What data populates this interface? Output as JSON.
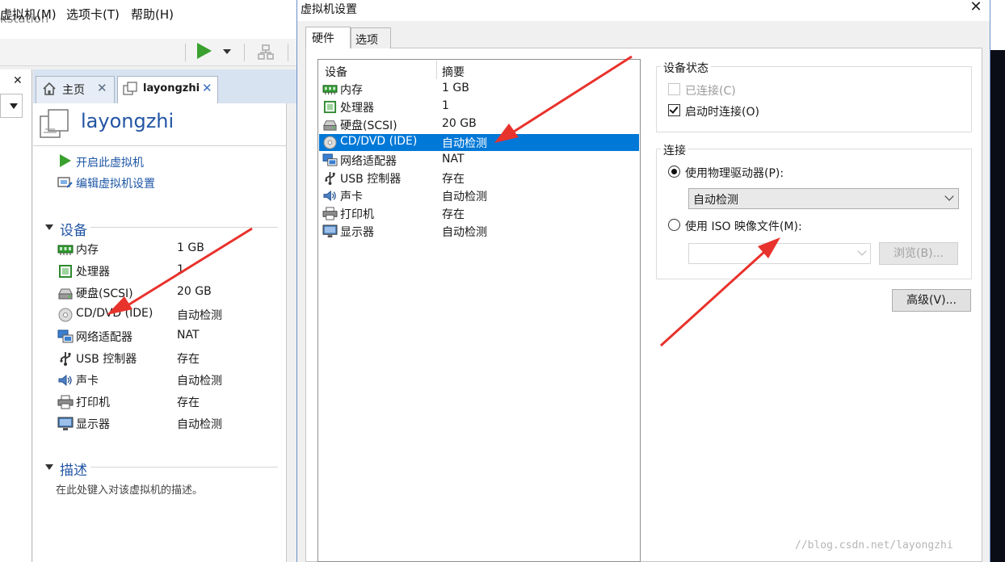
{
  "background_window": {
    "title": "kstation",
    "menu": [
      "虚拟机(M)",
      "选项卡(T)",
      "帮助(H)"
    ],
    "tabs": [
      {
        "label": "主页"
      },
      {
        "label": "layongzhi"
      }
    ],
    "vm_name": "layongzhi",
    "actions": [
      "开启此虚拟机",
      "编辑虚拟机设置"
    ],
    "devices_section": "设备",
    "devices": [
      {
        "icon": "memory-icon",
        "name": "内存",
        "value": "1 GB"
      },
      {
        "icon": "processor-icon",
        "name": "处理器",
        "value": "1"
      },
      {
        "icon": "hard-disk-icon",
        "name": "硬盘(SCSI)",
        "value": "20 GB"
      },
      {
        "icon": "cd-dvd-icon",
        "name": "CD/DVD (IDE)",
        "value": "自动检测"
      },
      {
        "icon": "network-adapter-icon",
        "name": "网络适配器",
        "value": "NAT"
      },
      {
        "icon": "usb-icon",
        "name": "USB 控制器",
        "value": "存在"
      },
      {
        "icon": "sound-icon",
        "name": "声卡",
        "value": "自动检测"
      },
      {
        "icon": "printer-icon",
        "name": "打印机",
        "value": "存在"
      },
      {
        "icon": "display-icon",
        "name": "显示器",
        "value": "自动检测"
      }
    ],
    "description_section": "描述",
    "description_placeholder": "在此处键入对该虚拟机的描述。"
  },
  "dialog": {
    "title": "虚拟机设置",
    "tabs": [
      {
        "label": "硬件",
        "active": true
      },
      {
        "label": "选项",
        "active": false
      }
    ],
    "hardware_list": {
      "columns": [
        "设备",
        "摘要"
      ],
      "selected_index": 3,
      "rows": [
        {
          "icon": "memory-icon",
          "device": "内存",
          "summary": "1 GB"
        },
        {
          "icon": "processor-icon",
          "device": "处理器",
          "summary": "1"
        },
        {
          "icon": "hard-disk-icon",
          "device": "硬盘(SCSI)",
          "summary": "20 GB"
        },
        {
          "icon": "cd-dvd-icon",
          "device": "CD/DVD (IDE)",
          "summary": "自动检测"
        },
        {
          "icon": "network-adapter-icon",
          "device": "网络适配器",
          "summary": "NAT"
        },
        {
          "icon": "usb-icon",
          "device": "USB 控制器",
          "summary": "存在"
        },
        {
          "icon": "sound-icon",
          "device": "声卡",
          "summary": "自动检测"
        },
        {
          "icon": "printer-icon",
          "device": "打印机",
          "summary": "存在"
        },
        {
          "icon": "display-icon",
          "device": "显示器",
          "summary": "自动检测"
        }
      ]
    },
    "device_status": {
      "title": "设备状态",
      "connected_label": "已连接(C)",
      "connected_checked": false,
      "connected_enabled": false,
      "connect_at_power_on_label": "启动时连接(O)",
      "connect_at_power_on_checked": true
    },
    "connection": {
      "title": "连接",
      "physical_drive_label": "使用物理驱动器(P):",
      "physical_drive_selected": true,
      "physical_drive_value": "自动检测",
      "iso_label": "使用 ISO 映像文件(M):",
      "iso_selected": false,
      "iso_value": "",
      "browse_label": "浏览(B)..."
    },
    "advanced_label": "高级(V)..."
  },
  "watermark": "//blog.csdn.net/layongzhi",
  "colors": {
    "selection": "#0078d7",
    "link": "#1d56a5",
    "annotation_arrow": "#e8322c",
    "play": "#3aa02e"
  }
}
